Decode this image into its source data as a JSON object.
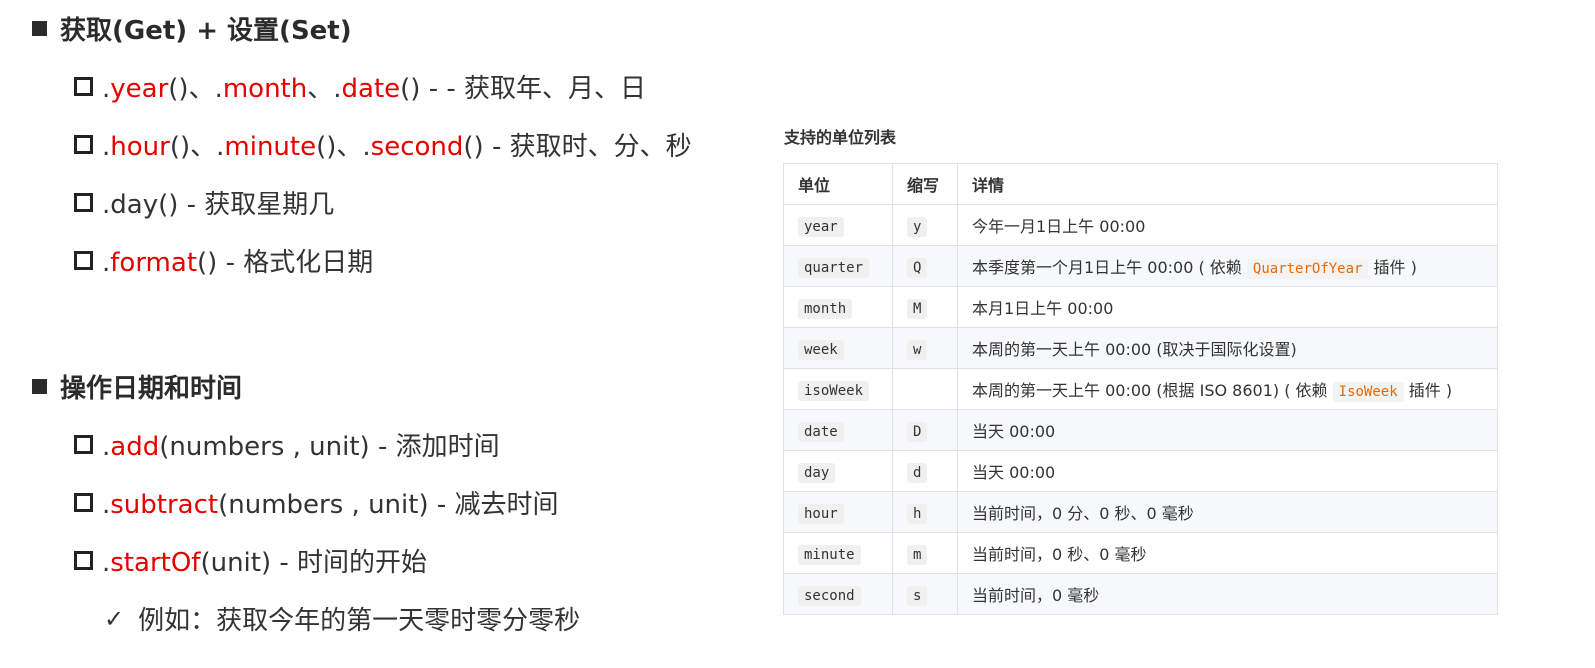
{
  "section1": {
    "title": "获取(Get) + 设置(Set)"
  },
  "bullets1": [
    {
      "parts": [
        [
          ".",
          "p"
        ],
        [
          "year",
          "r"
        ],
        [
          "()、",
          "p"
        ],
        [
          ".",
          "p"
        ],
        [
          "month",
          "r"
        ],
        [
          "、",
          "p"
        ],
        [
          ".",
          "p"
        ],
        [
          "date",
          "r"
        ],
        [
          "() - -  获取年、月、日",
          "p"
        ]
      ]
    },
    {
      "parts": [
        [
          ".",
          "p"
        ],
        [
          "hour",
          "r"
        ],
        [
          "()、",
          "p"
        ],
        [
          ".",
          "p"
        ],
        [
          "minute",
          "r"
        ],
        [
          "()、",
          "p"
        ],
        [
          ".",
          "p"
        ],
        [
          "second",
          "r"
        ],
        [
          "()   -  获取时、分、秒",
          "p"
        ]
      ]
    },
    {
      "parts": [
        [
          ".day()  - 获取星期几",
          "p"
        ]
      ]
    },
    {
      "parts": [
        [
          ".",
          "p"
        ],
        [
          "format",
          "r"
        ],
        [
          "()  - 格式化日期",
          "p"
        ]
      ]
    }
  ],
  "section2": {
    "title": "操作日期和时间"
  },
  "bullets2": [
    {
      "parts": [
        [
          ".",
          "p"
        ],
        [
          "add",
          "r"
        ],
        [
          "(numbers , unit) - 添加时间",
          "p"
        ]
      ]
    },
    {
      "parts": [
        [
          ".",
          "p"
        ],
        [
          "subtract",
          "r"
        ],
        [
          "(numbers , unit)  - 减去时间",
          "p"
        ]
      ]
    },
    {
      "parts": [
        [
          ".",
          "p"
        ],
        [
          "startOf",
          "r"
        ],
        [
          "(unit) - 时间的开始",
          "p"
        ]
      ]
    }
  ],
  "example": {
    "mark": "✓",
    "text": "例如：获取今年的第一天零时零分零秒"
  },
  "table": {
    "title": "支持的单位列表",
    "headers": [
      "单位",
      "缩写",
      "详情"
    ],
    "rows": [
      {
        "unit": "year",
        "abbr": "y",
        "detail": [
          [
            "今年一月1日上午 00:00",
            "t"
          ]
        ]
      },
      {
        "unit": "quarter",
        "abbr": "Q",
        "detail": [
          [
            "本季度第一个月1日上午 00:00 ( 依赖 ",
            "t"
          ],
          [
            "QuarterOfYear",
            "c"
          ],
          [
            " 插件 )",
            "t"
          ]
        ]
      },
      {
        "unit": "month",
        "abbr": "M",
        "detail": [
          [
            "本月1日上午 00:00",
            "t"
          ]
        ]
      },
      {
        "unit": "week",
        "abbr": "w",
        "detail": [
          [
            "本周的第一天上午 00:00 (取决于国际化设置)",
            "t"
          ]
        ]
      },
      {
        "unit": "isoWeek",
        "abbr": "",
        "detail": [
          [
            "本周的第一天上午 00:00 (根据 ISO 8601) ( 依赖 ",
            "t"
          ],
          [
            "IsoWeek",
            "c"
          ],
          [
            " 插件 )",
            "t"
          ]
        ]
      },
      {
        "unit": "date",
        "abbr": "D",
        "detail": [
          [
            "当天 00:00",
            "t"
          ]
        ]
      },
      {
        "unit": "day",
        "abbr": "d",
        "detail": [
          [
            "当天 00:00",
            "t"
          ]
        ]
      },
      {
        "unit": "hour",
        "abbr": "h",
        "detail": [
          [
            "当前时间，0 分、0 秒、0 毫秒",
            "t"
          ]
        ]
      },
      {
        "unit": "minute",
        "abbr": "m",
        "detail": [
          [
            "当前时间，0 秒、0 毫秒",
            "t"
          ]
        ]
      },
      {
        "unit": "second",
        "abbr": "s",
        "detail": [
          [
            "当前时间，0 毫秒",
            "t"
          ]
        ]
      }
    ]
  },
  "colors": {
    "method_red": "#e60000",
    "plugin_code": "#e96900"
  }
}
